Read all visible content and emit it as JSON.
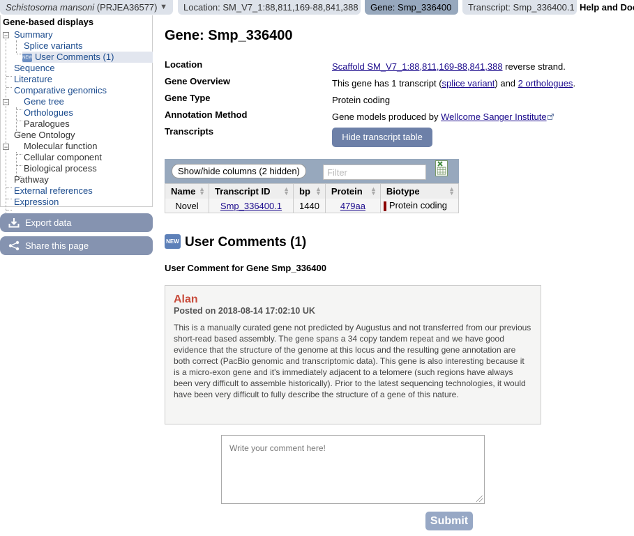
{
  "tabs": {
    "species_italic": "Schistosoma mansoni",
    "species_rest": " (PRJEA36577)",
    "location": "Location: SM_V7_1:88,811,169-88,841,388",
    "gene": "Gene: Smp_336400",
    "transcript": "Transcript: Smp_336400.1",
    "help": "Help and Doc"
  },
  "sidebar": {
    "title": "Gene-based displays",
    "items": {
      "summary": "Summary",
      "splice_variants": "Splice variants",
      "user_comments": "User Comments (1)",
      "sequence": "Sequence",
      "literature": "Literature",
      "comparative_genomics": "Comparative genomics",
      "gene_tree": "Gene tree",
      "orthologues": "Orthologues",
      "paralogues": "Paralogues",
      "gene_ontology": "Gene Ontology",
      "molecular_function": "Molecular function",
      "cellular_component": "Cellular component",
      "biological_process": "Biological process",
      "pathway": "Pathway",
      "external_references": "External references",
      "expression": "Expression"
    },
    "new_badge": "NEW",
    "export_data": "Export data",
    "share_page": "Share this page"
  },
  "main": {
    "title": "Gene: Smp_336400",
    "location_label": "Location",
    "location_link": "Scaffold SM_V7_1:88,811,169-88,841,388",
    "location_suffix": " reverse strand.",
    "overview_label": "Gene Overview",
    "overview_prefix": "This gene has 1 transcript (",
    "overview_link1": "splice variant",
    "overview_mid": ") and ",
    "overview_link2": "2 orthologues",
    "overview_suffix": ".",
    "type_label": "Gene Type",
    "type_value": "Protein coding",
    "annotation_label": "Annotation Method",
    "annotation_prefix": "Gene models produced by ",
    "annotation_link": "Wellcome Sanger Institute",
    "transcripts_label": "Transcripts",
    "hide_table_button": "Hide transcript table"
  },
  "transcript_table": {
    "show_hide_button": "Show/hide columns (2 hidden)",
    "filter_placeholder": "Filter",
    "columns": [
      "Name",
      "Transcript ID",
      "bp",
      "Protein",
      "Biotype"
    ],
    "rows": [
      {
        "name": "Novel",
        "transcript_id": "Smp_336400.1",
        "bp": "1440",
        "protein": "479aa",
        "biotype": "Protein coding",
        "biotype_color": "#8b0000"
      }
    ]
  },
  "comments": {
    "section_title": "User Comments (1)",
    "new_badge": "NEW",
    "subtitle": "User Comment for Gene Smp_336400",
    "author": "Alan",
    "posted": "Posted on 2018-08-14 17:02:10 UK",
    "body": "This is a manually curated gene not predicted by Augustus and not transferred from our previous short-read based assembly. The gene spans a 34 copy tandem repeat and we have good evidence that the structure of the genome at this locus and the resulting gene annotation are both correct (PacBio genomic and transcriptomic data). This gene is also interesting because it is a micro-exon gene and it's immediately adjacent to a telomere (such regions have always been very difficult to assemble historically). Prior to the latest sequencing technologies, it would have been very difficult to fully describe the structure of a gene of this nature.",
    "input_placeholder": "Write your comment here!",
    "submit_label": "Submit"
  },
  "colors": {
    "accent": "#97a8bd",
    "sidebar_button": "#8593b0",
    "link": "#1b0a8c",
    "author": "#c84c3c"
  }
}
